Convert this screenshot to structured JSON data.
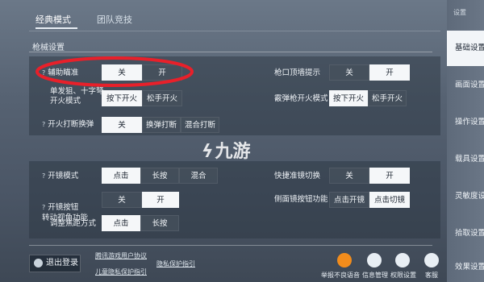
{
  "tabs": {
    "classic": "经典模式",
    "team": "团队竞技"
  },
  "section_title": "枪械设置",
  "rows": {
    "aim_assist": {
      "label": "辅助瞄准",
      "opts": [
        "关",
        "开"
      ]
    },
    "sniper_fire": {
      "label": "单发狙、十字弩\n开火模式",
      "opts": [
        "按下开火",
        "松手开火"
      ]
    },
    "fire_switch": {
      "label": "开火打断换弹",
      "opts": [
        "关",
        "换弹打断",
        "混合打断"
      ]
    },
    "wall_hint": {
      "label": "枪口顶墙提示",
      "opts": [
        "关",
        "开"
      ]
    },
    "shotgun_fire": {
      "label": "霰弹枪开火模式",
      "opts": [
        "按下开火",
        "松手开火"
      ]
    },
    "scope_mode": {
      "label": "开镜模式",
      "opts": [
        "点击",
        "长按",
        "混合"
      ]
    },
    "scope_view": {
      "label": "开镜按钮\n转动视角功能",
      "opts": [
        "关",
        "开"
      ]
    },
    "zoom_mode": {
      "label": "调整焦距方式",
      "opts": [
        "点击",
        "长按"
      ]
    },
    "quick_scope": {
      "label": "快捷准镜切换",
      "opts": [
        "关",
        "开"
      ]
    },
    "side_scope": {
      "label": "侧面镜按钮功能",
      "opts": [
        "点击开镜",
        "点击切镜"
      ]
    }
  },
  "watermark": "九游",
  "sidebar": {
    "top": "设置",
    "items": [
      "基础设置",
      "画面设置",
      "操作设置",
      "载具设置",
      "灵敏度设",
      "拾取设置",
      "效果设置"
    ]
  },
  "bottom": {
    "logout": "退出登录",
    "link1": "腾讯游戏用户协议",
    "link2": "儿童隐私保护指引",
    "link3": "隐私保护指引",
    "icons": [
      "举报不良语音",
      "信息管理",
      "权限设置",
      "客服"
    ]
  }
}
